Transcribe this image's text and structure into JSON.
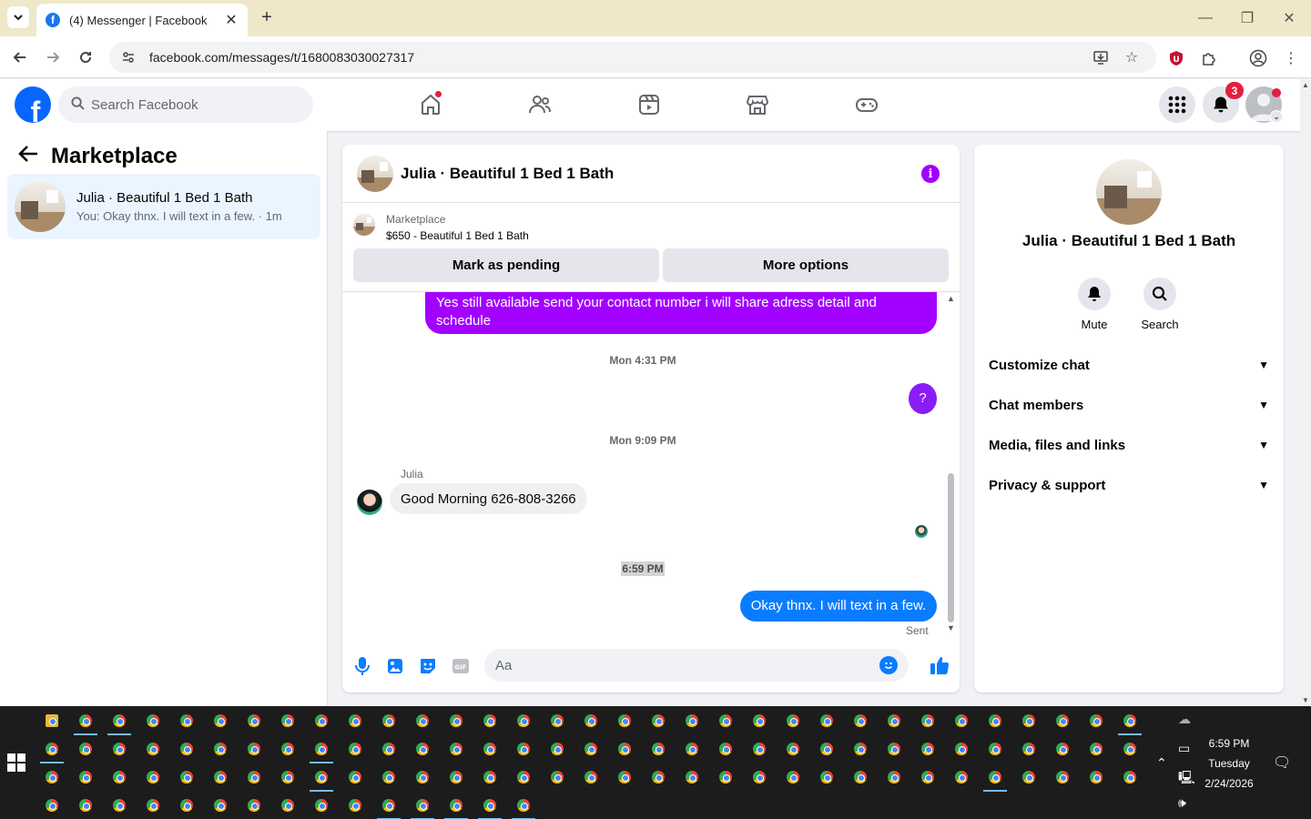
{
  "browser": {
    "tab_title": "(4) Messenger | Facebook",
    "url": "facebook.com/messages/t/1680083030027317"
  },
  "fb_header": {
    "search_placeholder": "Search Facebook",
    "notifications_count": "3"
  },
  "sidebar": {
    "title": "Marketplace",
    "conversation": {
      "name": "Julia · Beautiful 1 Bed 1 Bath",
      "preview": "You: Okay thnx. I will text in a few. · 1m"
    }
  },
  "chat": {
    "title": "Julia · Beautiful 1 Bed 1 Bath",
    "marketplace_label": "Marketplace",
    "listing": "$650 - Beautiful 1 Bed 1 Bath",
    "mark_pending": "Mark as pending",
    "more_options": "More options",
    "messages": {
      "out_1": "Yes still available send your contact number i will share adress detail and schedule",
      "ts_1": "Mon 4:31 PM",
      "out_2": "?",
      "ts_2": "Mon 9:09 PM",
      "sender": "Julia",
      "in_1": "Good Morning 626-808-3266",
      "ts_3": "6:59 PM",
      "out_3": "Okay thnx. I will text in a few.",
      "status": "Sent"
    },
    "composer_placeholder": "Aa"
  },
  "info_panel": {
    "name": "Julia · Beautiful 1 Bed 1 Bath",
    "actions": [
      "Mute",
      "Search"
    ],
    "sections": [
      "Customize chat",
      "Chat members",
      "Media, files and links",
      "Privacy & support"
    ]
  },
  "taskbar": {
    "time": "6:59 PM",
    "day": "Tuesday",
    "date": "2/24/2026"
  },
  "colors": {
    "messenger_purple": "#a200ff",
    "messenger_blue": "#0a7cff",
    "facebook_blue": "#0866ff"
  }
}
